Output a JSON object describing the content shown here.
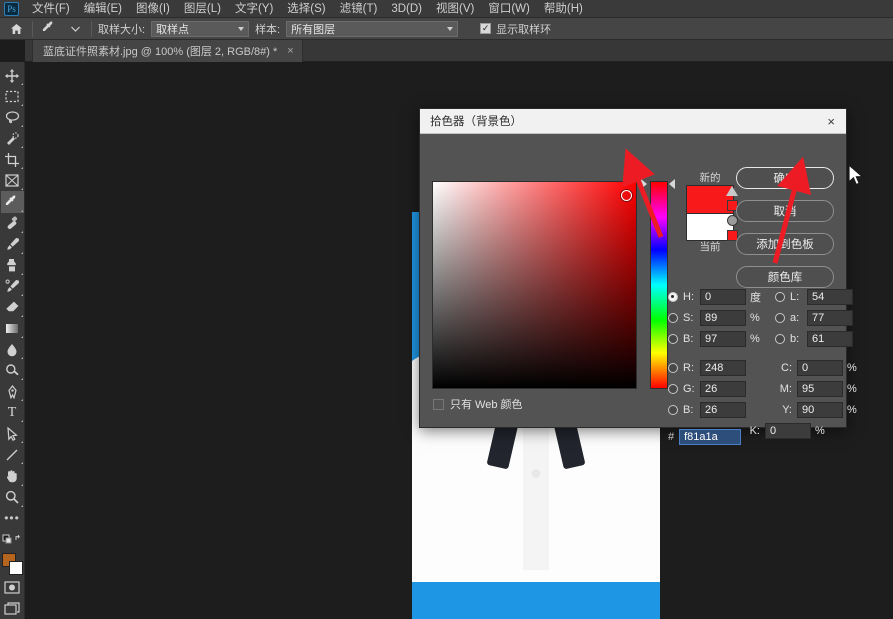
{
  "app": {
    "logo_text": "Ps",
    "menu": [
      {
        "label": "文件(F)"
      },
      {
        "label": "编辑(E)"
      },
      {
        "label": "图像(I)"
      },
      {
        "label": "图层(L)"
      },
      {
        "label": "文字(Y)"
      },
      {
        "label": "选择(S)"
      },
      {
        "label": "滤镜(T)"
      },
      {
        "label": "3D(D)"
      },
      {
        "label": "视图(V)"
      },
      {
        "label": "窗口(W)"
      },
      {
        "label": "帮助(H)"
      }
    ]
  },
  "options_bar": {
    "home_icon": "home-icon",
    "tool_icon": "eyedropper-icon",
    "sample_size_label": "取样大小:",
    "sample_size_value": "取样点",
    "sample_label": "样本:",
    "sample_value": "所有图层",
    "show_ring_label": "显示取样环",
    "show_ring_checked": true,
    "check_glyph": "✓"
  },
  "document_tab": {
    "title": "蓝底证件照素材.jpg @ 100% (图层 2, RGB/8#) *",
    "close_glyph": "×"
  },
  "toolbar": {
    "items": [
      {
        "name": "move-tool",
        "active": false
      },
      {
        "name": "marquee-tool",
        "active": false
      },
      {
        "name": "lasso-tool",
        "active": false
      },
      {
        "name": "quick-selection-tool",
        "active": false
      },
      {
        "name": "crop-tool",
        "active": false
      },
      {
        "name": "frame-tool",
        "active": false
      },
      {
        "name": "eyedropper-tool",
        "active": true
      },
      {
        "name": "healing-brush-tool",
        "active": false
      },
      {
        "name": "brush-tool",
        "active": false
      },
      {
        "name": "clone-stamp-tool",
        "active": false
      },
      {
        "name": "history-brush-tool",
        "active": false
      },
      {
        "name": "eraser-tool",
        "active": false
      },
      {
        "name": "gradient-tool",
        "active": false
      },
      {
        "name": "blur-tool",
        "active": false
      },
      {
        "name": "dodge-tool",
        "active": false
      },
      {
        "name": "pen-tool",
        "active": false
      },
      {
        "name": "type-tool",
        "active": false
      },
      {
        "name": "path-selection-tool",
        "active": false
      },
      {
        "name": "line-tool",
        "active": false
      },
      {
        "name": "hand-tool",
        "active": false
      },
      {
        "name": "zoom-tool",
        "active": false
      }
    ],
    "more_glyph": "•••",
    "foreground_color": "#b5651d",
    "background_color": "#ffffff",
    "type_glyph": "T"
  },
  "canvas": {
    "photo_background_color": "#1f96e3",
    "shirt_color": "#fdfdfd",
    "hair_color": "#17161b",
    "bowtie_color": "#22242e"
  },
  "color_picker": {
    "title": "拾色器（背景色）",
    "close_glyph": "×",
    "new_label": "新的",
    "current_label": "当前",
    "new_color": "#f81a1a",
    "current_color": "#ffffff",
    "buttons": [
      {
        "label": "确定",
        "primary": true,
        "name": "ok-button"
      },
      {
        "label": "取消",
        "primary": false,
        "name": "cancel-button"
      },
      {
        "label": "添加到色板",
        "primary": false,
        "name": "add-to-swatches-button"
      },
      {
        "label": "颜色库",
        "primary": false,
        "name": "color-libraries-button"
      }
    ],
    "web_only_label": "只有 Web 颜色",
    "web_only_checked": false,
    "hex_prefix": "#",
    "hex_value": "f81a1a",
    "fields": {
      "hsb": [
        {
          "label": "H:",
          "value": "0",
          "unit": "度",
          "selected": true
        },
        {
          "label": "S:",
          "value": "89",
          "unit": "%",
          "selected": false
        },
        {
          "label": "B:",
          "value": "97",
          "unit": "%",
          "selected": false
        }
      ],
      "lab": [
        {
          "label": "L:",
          "value": "54",
          "unit": "",
          "selected": false
        },
        {
          "label": "a:",
          "value": "77",
          "unit": "",
          "selected": false
        },
        {
          "label": "b:",
          "value": "61",
          "unit": "",
          "selected": false
        }
      ],
      "rgb": [
        {
          "label": "R:",
          "value": "248",
          "unit": "",
          "selected": false
        },
        {
          "label": "G:",
          "value": "26",
          "unit": "",
          "selected": false
        },
        {
          "label": "B:",
          "value": "26",
          "unit": "",
          "selected": false
        }
      ],
      "cmyk": [
        {
          "label": "C:",
          "value": "0",
          "unit": "%"
        },
        {
          "label": "M:",
          "value": "95",
          "unit": "%"
        },
        {
          "label": "Y:",
          "value": "90",
          "unit": "%"
        },
        {
          "label": "K:",
          "value": "0",
          "unit": "%"
        }
      ]
    }
  },
  "annotations": {
    "arrow_color": "#ed1c24",
    "arrow_count": 2
  }
}
